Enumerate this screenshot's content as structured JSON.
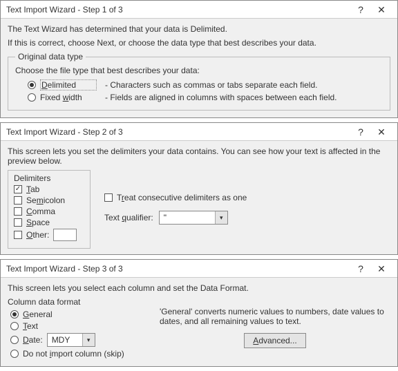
{
  "step1": {
    "title": "Text Import Wizard - Step 1 of 3",
    "intro1": "The Text Wizard has determined that your data is Delimited.",
    "intro2": "If this is correct, choose Next, or choose the data type that best describes your data.",
    "group_label": "Original data type",
    "choose_label": "Choose the file type that best describes your data:",
    "opt_delimited": "Delimited",
    "opt_delimited_desc": "- Characters such as commas or tabs separate each field.",
    "opt_fixed": "Fixed width",
    "opt_fixed_desc": "- Fields are aligned in columns with spaces between each field."
  },
  "step2": {
    "title": "Text Import Wizard - Step 2 of 3",
    "intro": "This screen lets you set the delimiters your data contains.  You can see how your text is affected in the preview below.",
    "delimiters_label": "Delimiters",
    "tab": "Tab",
    "semicolon": "Semicolon",
    "comma": "Comma",
    "space": "Space",
    "other": "Other:",
    "treat": "Treat consecutive delimiters as one",
    "qualifier_label": "Text qualifier:",
    "qualifier_value": "\""
  },
  "step3": {
    "title": "Text Import Wizard - Step 3 of 3",
    "intro": "This screen lets you select each column and set the Data Format.",
    "group_label": "Column data format",
    "general": "General",
    "text": "Text",
    "date": "Date:",
    "date_value": "MDY",
    "skip": "Do not import column (skip)",
    "general_desc": "'General' converts numeric values to numbers, date values to dates, and all remaining values to text.",
    "advanced": "Advanced..."
  },
  "common": {
    "help": "?",
    "close": "✕"
  }
}
